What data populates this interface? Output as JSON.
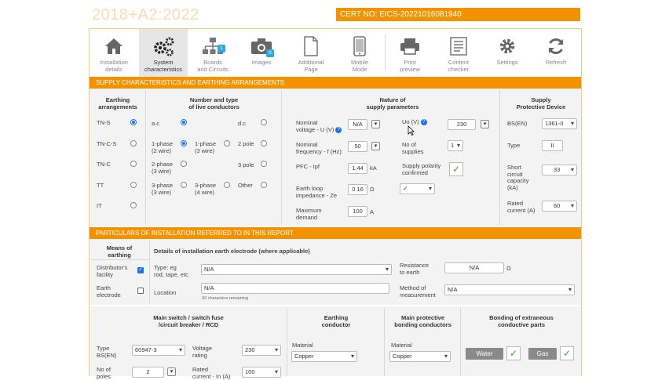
{
  "header": {
    "title": "2018+A2:2022",
    "cert_no": "CERT NO: EICS-20221016081940"
  },
  "toolbar": [
    {
      "label1": "Installation",
      "label2": "details"
    },
    {
      "label1": "System",
      "label2": "characteristics"
    },
    {
      "label1": "Boards",
      "label2": "and Circuits",
      "badge": "1"
    },
    {
      "label1": "Images",
      "label2": "",
      "badge": "0"
    },
    {
      "label1": "Additional",
      "label2": "Page"
    },
    {
      "label1": "Mobile",
      "label2": "Mode"
    },
    {
      "label1": "Print",
      "label2": "preview"
    },
    {
      "label1": "Content",
      "label2": "checker"
    },
    {
      "label1": "Settings",
      "label2": ""
    },
    {
      "label1": "Refresh",
      "label2": ""
    }
  ],
  "supply": {
    "title": "SUPPLY CHARACTERISTICS AND EARTHING ARRANGEMENTS",
    "earthing": {
      "h1": "Earthing",
      "h2": "arrangements",
      "options": [
        "TN-S",
        "TN-C-S",
        "TN-C",
        "TT",
        "IT"
      ]
    },
    "conductors": {
      "h1": "Number and type",
      "h2": "of live conductors",
      "ac": "a.c",
      "dc": "d.c",
      "p1w2_1": "1-phase",
      "p1w2_2": "(2 wire)",
      "p1w3_1": "1-phase",
      "p1w3_2": "(3 wire)",
      "p2w3_1": "2-phase",
      "p2w3_2": "(3 wire)",
      "p3w3_1": "3-phase",
      "p3w3_2": "(3 wire)",
      "p3w4_1": "3-phase",
      "p3w4_2": "(4 wire)",
      "pole2": "2 pole",
      "pole3": "3 pole",
      "other": "Other"
    },
    "params": {
      "h1": "Nature of",
      "h2": "supply parameters",
      "nominal_u_1": "Nominal",
      "nominal_u_2": "voltage - U (V)",
      "nominal_u_val": "N/A",
      "uo_label": "Uo (V)",
      "uo_val": "230",
      "freq_1": "Nominal",
      "freq_2": "frequency - f (Hz)",
      "freq_val": "50",
      "supplies_1": "No of",
      "supplies_2": "supplies",
      "supplies_val": "1",
      "pfc_label": "PFC - Ipf",
      "pfc_val": "1.44",
      "pfc_unit": "kA",
      "polarity_1": "Supply polarity",
      "polarity_2": "confirmed",
      "polarity_mark": "✓",
      "loop_1": "Earth loop",
      "loop_2": "impedance - Ze",
      "loop_val": "0.16",
      "loop_unit": "Ω",
      "polarity_select": "✓",
      "max_1": "Maximum",
      "max_2": "demand",
      "max_val": "100",
      "max_unit": "A"
    },
    "device": {
      "h1": "Supply",
      "h2": "Protective Device",
      "bs_label": "BS(EN)",
      "bs_val": "1361-II",
      "type_label": "Type",
      "type_val": "II",
      "short_1": "Short",
      "short_2": "circuit",
      "short_3": "capacity",
      "short_4": "(kA)",
      "short_val": "33",
      "rated_1": "Rated",
      "rated_2": "current (A)",
      "rated_val": "60"
    }
  },
  "particulars": {
    "title": "PARTICULARS OF INSTALLATION REFERRED TO IN THIS REPORT",
    "means_1": "Means of",
    "means_2": "earthing",
    "details_h": "Details of installation earth electrode (where applicable)",
    "distributor_1": "Distributor's",
    "distributor_2": "facility",
    "electrode_1": "Earth",
    "electrode_2": "electrode",
    "type_1": "Type: eg",
    "type_2": "rod, tape, etc",
    "type_val": "N/A",
    "resistance_1": "Resistance",
    "resistance_2": "to earth",
    "resistance_val": "N/A",
    "resistance_unit": "Ω",
    "location_label": "Location",
    "location_val": "N/A",
    "location_hint": "42 characters remaining",
    "method_1": "Method of",
    "method_2": "measurement",
    "method_val": "N/A"
  },
  "main_switch": {
    "h1": "Main switch / switch fuse",
    "h2": "/circuit breaker / RCD",
    "type_1": "Type",
    "type_2": "BS(EN)",
    "type_val": "60947-3",
    "voltage_1": "Voltage",
    "voltage_2": "rating",
    "voltage_val": "230",
    "poles_1": "No of",
    "poles_2": "poles",
    "poles_val": "2",
    "rated_1": "Rated",
    "rated_2": "current - In (A)",
    "rated_val": "100"
  },
  "earthing_conductor": {
    "h1": "Earthing",
    "h2": "conductor",
    "material_label": "Material",
    "material_val": "Copper"
  },
  "bonding_conductors": {
    "h1": "Main protective",
    "h2": "bonding conductors",
    "material_label": "Material",
    "material_val": "Copper"
  },
  "extraneous": {
    "h1": "Bonding of extraneous",
    "h2": "conductive parts",
    "water": "Water",
    "gas": "Gas",
    "mark": "✓"
  },
  "colors": {
    "accent": "#f39200",
    "panel": "#f3f3f3",
    "blue": "#1a73e8",
    "green": "#3aaa35"
  }
}
